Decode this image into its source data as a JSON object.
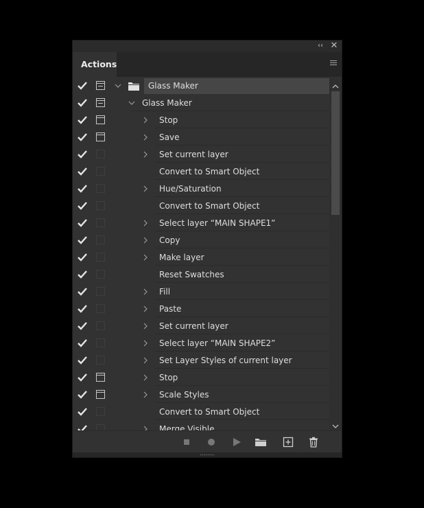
{
  "panel": {
    "tab_label": "Actions",
    "collapse_glyph": "‹‹",
    "close_glyph": "✕"
  },
  "rows": [
    {
      "type": "set",
      "label": "Glass Maker",
      "checked": true,
      "dialog": "partial",
      "expanded": true,
      "icon": "folder-icon"
    },
    {
      "type": "action",
      "label": "Glass Maker",
      "checked": true,
      "dialog": "partial",
      "expanded": true
    },
    {
      "type": "cmd",
      "label": "Stop",
      "checked": true,
      "dialog": "on",
      "chevron": true
    },
    {
      "type": "cmd",
      "label": "Save",
      "checked": true,
      "dialog": "on",
      "chevron": true
    },
    {
      "type": "cmd",
      "label": "Set current layer",
      "checked": true,
      "dialog": "off",
      "chevron": true
    },
    {
      "type": "cmd",
      "label": "Convert to Smart Object",
      "checked": true,
      "dialog": "off",
      "chevron": false
    },
    {
      "type": "cmd",
      "label": "Hue/Saturation",
      "checked": true,
      "dialog": "off",
      "chevron": true
    },
    {
      "type": "cmd",
      "label": "Convert to Smart Object",
      "checked": true,
      "dialog": "off",
      "chevron": false
    },
    {
      "type": "cmd",
      "label": "Select layer “MAIN SHAPE1”",
      "checked": true,
      "dialog": "off",
      "chevron": true
    },
    {
      "type": "cmd",
      "label": "Copy",
      "checked": true,
      "dialog": "off",
      "chevron": true
    },
    {
      "type": "cmd",
      "label": "Make layer",
      "checked": true,
      "dialog": "off",
      "chevron": true
    },
    {
      "type": "cmd",
      "label": "Reset Swatches",
      "checked": true,
      "dialog": "off",
      "chevron": false
    },
    {
      "type": "cmd",
      "label": "Fill",
      "checked": true,
      "dialog": "off",
      "chevron": true
    },
    {
      "type": "cmd",
      "label": "Paste",
      "checked": true,
      "dialog": "off",
      "chevron": true
    },
    {
      "type": "cmd",
      "label": "Set current layer",
      "checked": true,
      "dialog": "off",
      "chevron": true
    },
    {
      "type": "cmd",
      "label": "Select layer “MAIN SHAPE2”",
      "checked": true,
      "dialog": "off",
      "chevron": true
    },
    {
      "type": "cmd",
      "label": "Set Layer Styles of current layer",
      "checked": true,
      "dialog": "off",
      "chevron": true
    },
    {
      "type": "cmd",
      "label": "Stop",
      "checked": true,
      "dialog": "on",
      "chevron": true
    },
    {
      "type": "cmd",
      "label": "Scale Styles",
      "checked": true,
      "dialog": "on",
      "chevron": true
    },
    {
      "type": "cmd",
      "label": "Convert to Smart Object",
      "checked": true,
      "dialog": "off",
      "chevron": false
    },
    {
      "type": "cmd",
      "label": "Merge Visible",
      "checked": true,
      "dialog": "off",
      "chevron": true
    }
  ],
  "bottom_buttons": [
    {
      "name": "stop-playing-button",
      "icon": "stop-icon"
    },
    {
      "name": "begin-recording-button",
      "icon": "record-icon"
    },
    {
      "name": "play-selection-button",
      "icon": "play-icon"
    },
    {
      "name": "create-new-set-button",
      "icon": "folder-icon"
    },
    {
      "name": "create-new-action-button",
      "icon": "new-item-icon"
    },
    {
      "name": "delete-button",
      "icon": "trash-icon"
    }
  ],
  "colors": {
    "panel_bg": "#323232",
    "selected_row_bg": "#464646",
    "text": "#dedede"
  }
}
